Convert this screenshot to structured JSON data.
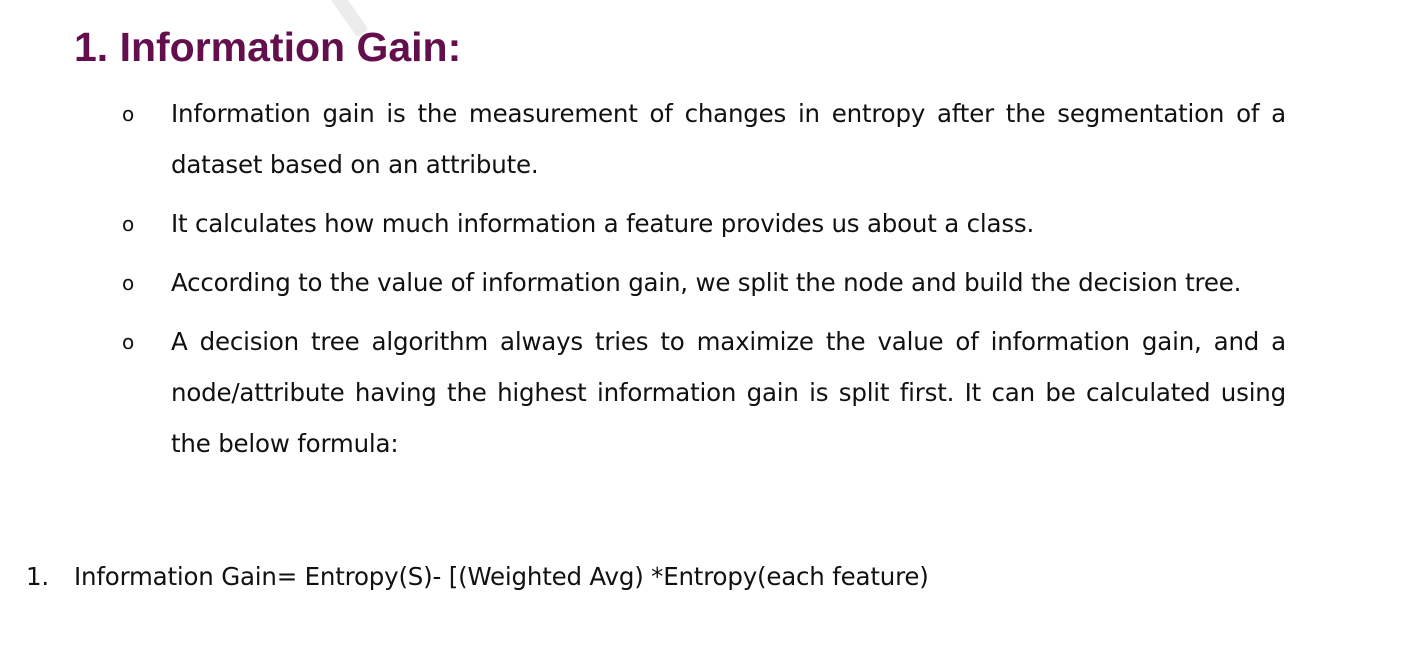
{
  "colors": {
    "heading": "#640F4D",
    "text": "#111111",
    "background": "#FFFFFF"
  },
  "heading": "1. Information Gain:",
  "bullet_marker": "o",
  "bullets": [
    "Information gain is the measurement of changes in entropy after the segmentation of a dataset based on an attribute.",
    "It calculates how much information a feature provides us about a class.",
    "According to the value of information gain, we split the node and build the decision tree.",
    "A decision tree algorithm always tries to maximize the value of information gain, and a node/attribute having the highest information gain is split first. It can be calculated using the below formula:"
  ],
  "formula": {
    "number": "1.",
    "text": "Information Gain= Entropy(S)- [(Weighted Avg) *Entropy(each feature)"
  }
}
